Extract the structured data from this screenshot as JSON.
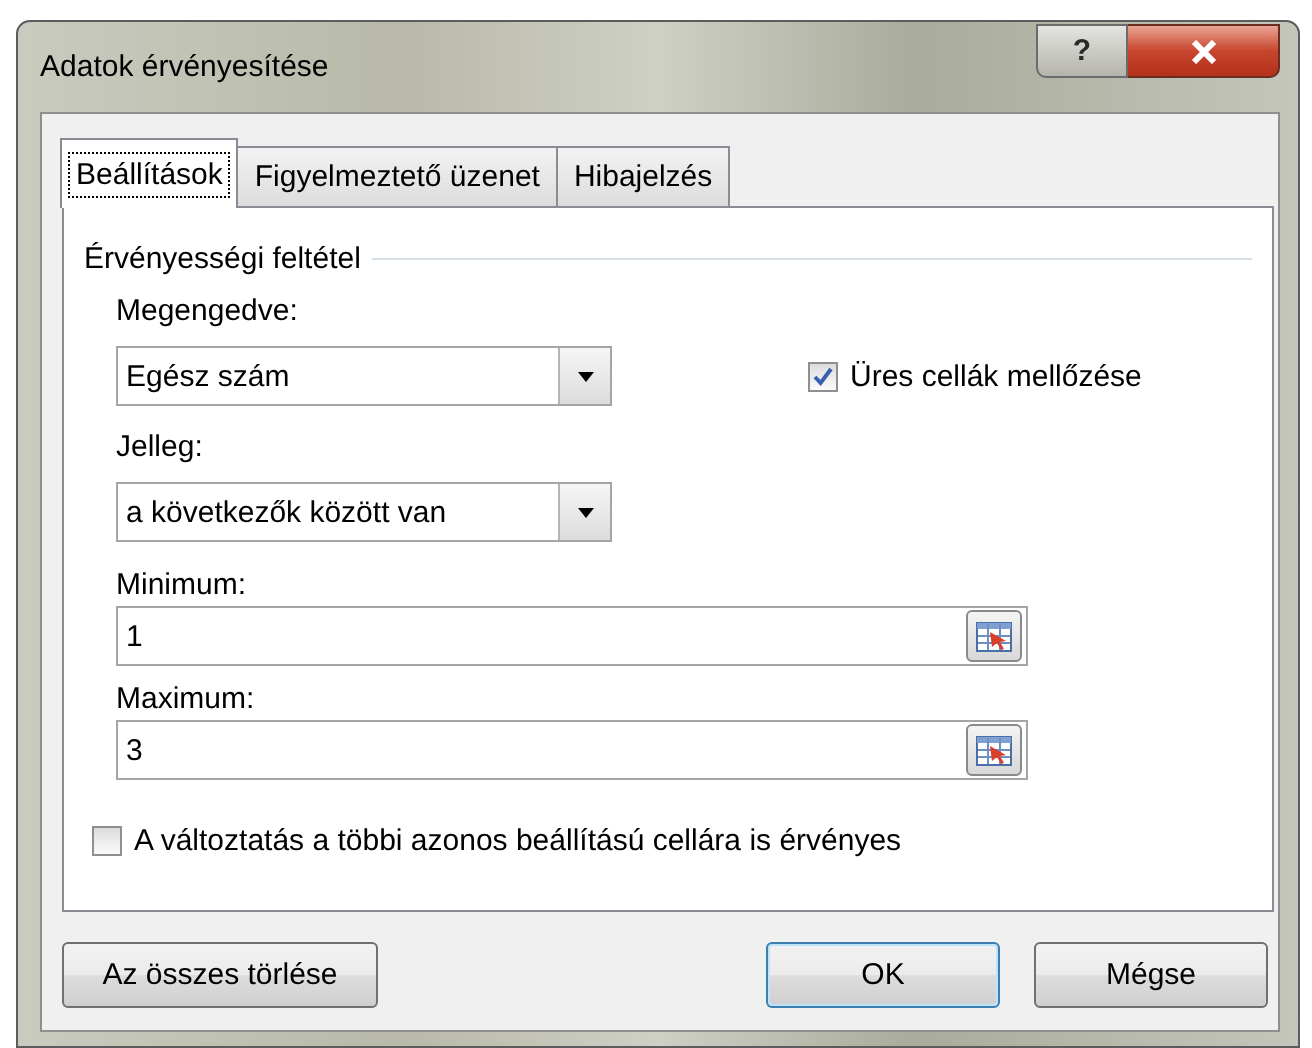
{
  "window": {
    "title": "Adatok érvényesítése",
    "help_button": "?"
  },
  "tabs": [
    {
      "label": "Beállítások",
      "selected": true
    },
    {
      "label": "Figyelmeztető üzenet",
      "selected": false
    },
    {
      "label": "Hibajelzés",
      "selected": false
    }
  ],
  "group": {
    "title": "Érvényességi feltétel"
  },
  "allow": {
    "label": "Megengedve:",
    "value": "Egész szám"
  },
  "ignore_blank": {
    "label": "Üres cellák mellőzése",
    "checked": true
  },
  "data": {
    "label": "Jelleg:",
    "value": "a következők között van"
  },
  "minimum": {
    "label": "Minimum:",
    "value": "1"
  },
  "maximum": {
    "label": "Maximum:",
    "value": "3"
  },
  "apply_to_all": {
    "label": "A változtatás a többi azonos beállítású cellára is érvényes",
    "checked": false
  },
  "buttons": [
    {
      "label": "Az összes törlése",
      "default": false
    },
    {
      "label": "OK",
      "default": true
    },
    {
      "label": "Mégse",
      "default": false
    }
  ]
}
